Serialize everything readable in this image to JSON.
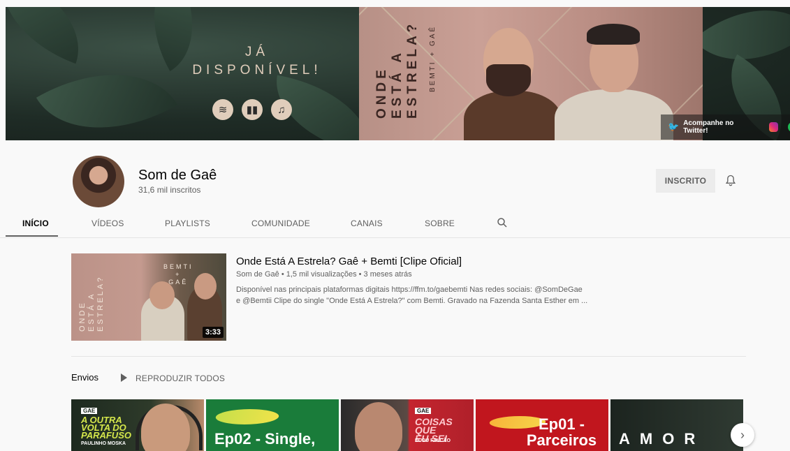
{
  "banner": {
    "headline_line1": "JÁ",
    "headline_line2": "DISPONÍVEL!",
    "platform_icons": [
      "spotify-icon",
      "deezer-icon",
      "apple-music-icon"
    ],
    "album_title_line1": "ONDE",
    "album_title_line2": "ESTÁ A",
    "album_title_line3": "ESTRELA?",
    "album_subtitle": "BEMTI + GAÊ",
    "twitter_cta": "Acompanhe no Twitter!"
  },
  "channel": {
    "name": "Som de Gaê",
    "subscribers": "31,6 mil inscritos",
    "subscribe_label": "INSCRITO"
  },
  "tabs": [
    {
      "label": "INÍCIO",
      "active": true
    },
    {
      "label": "VÍDEOS"
    },
    {
      "label": "PLAYLISTS"
    },
    {
      "label": "COMUNIDADE"
    },
    {
      "label": "CANAIS"
    },
    {
      "label": "SOBRE"
    }
  ],
  "featured": {
    "title": "Onde Está A Estrela? Gaê + Bemti [Clipe Oficial]",
    "meta": "Som de Gaê • 1,5 mil visualizações • 3 meses atrás",
    "description_line1": "Disponível nas principais plataformas digitais https://ffm.to/gaebemti Nas redes sociais: @SomDeGae",
    "description_line2": "e @Bemtii Clipe do single \"Onde Está A Estrela?\" com Bemti. Gravado na Fazenda Santa Esther em ...",
    "duration": "3:33",
    "thumb_title_line1": "ONDE",
    "thumb_title_line2": "ESTÁ A",
    "thumb_title_line3": "ESTRELA?",
    "thumb_sub_line1": "BEMTI",
    "thumb_sub_line2": "+",
    "thumb_sub_line3": "GAÊ"
  },
  "uploads": {
    "title": "Envios",
    "play_all": "REPRODUZIR TODOS",
    "cards": [
      {
        "tag": "GAE",
        "line1": "A OUTRA",
        "line2": "VOLTA DO",
        "line3": "PARAFUSO",
        "sub": "PAULINHO MOSKA"
      },
      {
        "text": "Ep02 - Single,"
      },
      {
        "tag": "GAE",
        "line1": "COISAS QUE",
        "line2": "EU SEI",
        "sub": "DUDU FALCÃO"
      },
      {
        "line1": "Ep01 -",
        "line2": "Parceiros"
      },
      {
        "text": "AMOR"
      }
    ]
  }
}
